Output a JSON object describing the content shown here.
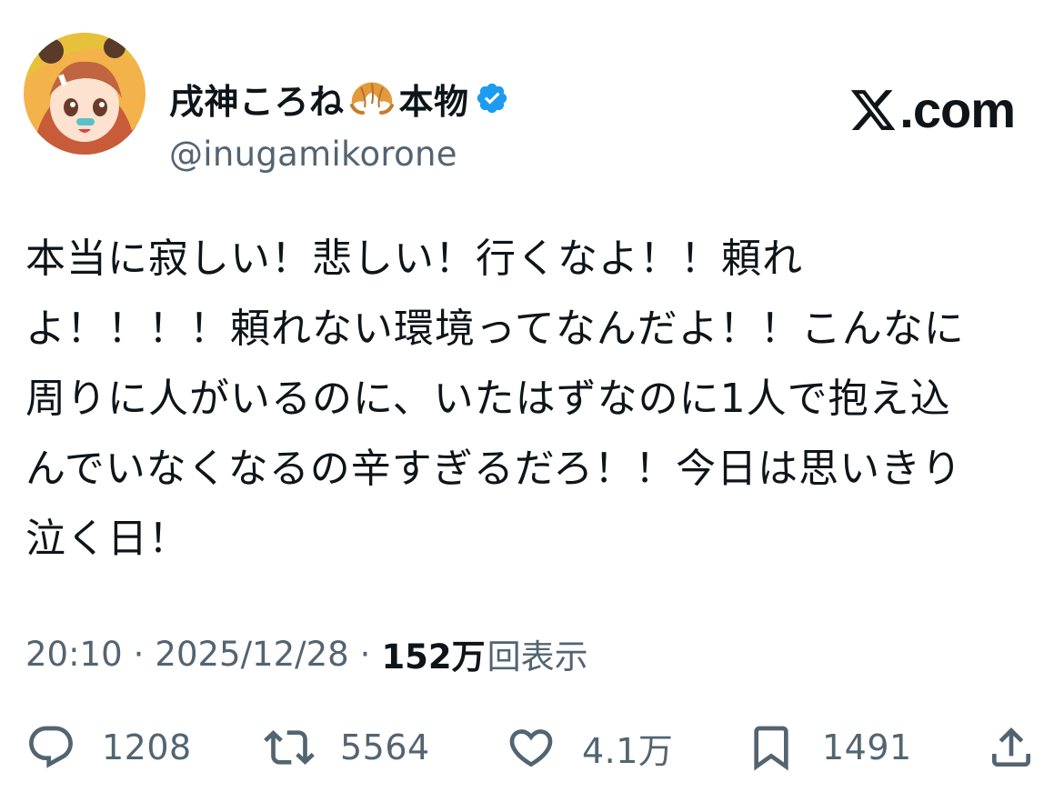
{
  "header": {
    "display_name_part1": "戌神ころね",
    "display_name_part2": "本物",
    "handle": "@inugamikorone",
    "avatar_icon": "avatar-image",
    "croissant_icon": "croissant-emoji",
    "verified_icon": "verified-badge-icon",
    "verified_color": "#1d9bf0",
    "site_logo_text": ".com"
  },
  "tweet": {
    "lines": [
      "本当に寂しい！悲しい！行くなよ！！頼れ",
      "よ！！！！頼れない環境ってなんだよ！！こんなに",
      "周りに人がいるのに、いたはずなのに1人で抱え込",
      "んでいなくなるの辛すぎるだろ！！今日は思いきり",
      "泣く日！"
    ]
  },
  "meta": {
    "time": "20:10",
    "separator": "·",
    "date": "2025/12/28",
    "views_count": "152万",
    "views_label": "回表示"
  },
  "actions": {
    "reply_count": "1208",
    "retweet_count": "5564",
    "like_count": "4.1万",
    "bookmark_count": "1491"
  },
  "colors": {
    "text": "#0f1419",
    "muted": "#536471",
    "verified": "#1d9bf0"
  }
}
